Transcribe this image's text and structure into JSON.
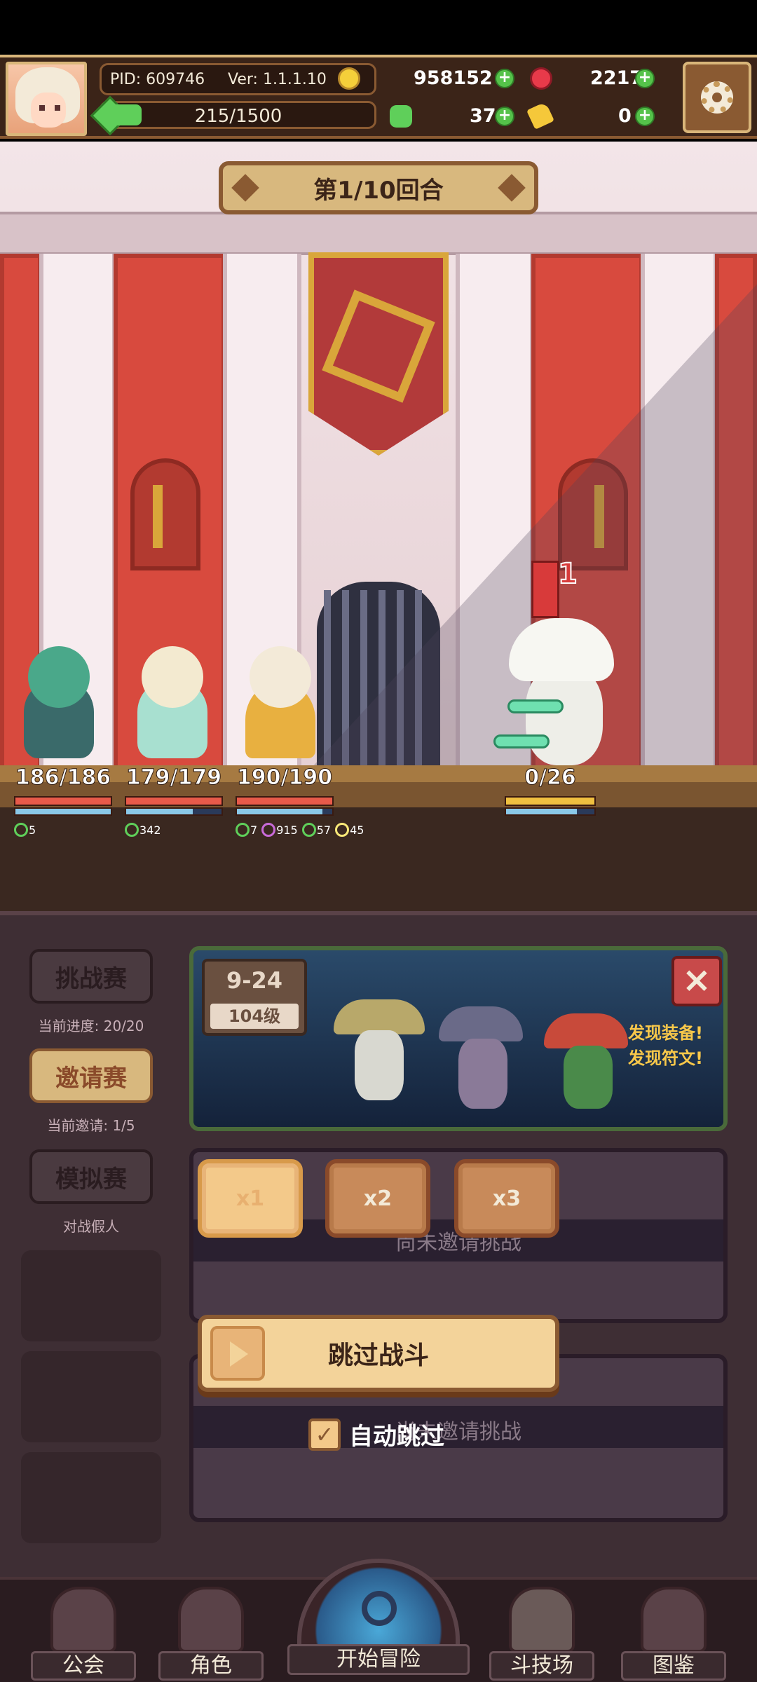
{
  "hud": {
    "pid": "PID: 609746",
    "version": "Ver: 1.1.1.10",
    "energy": "215/1500",
    "energy_fraction": 0.143,
    "coins": "958152",
    "gems": "2217",
    "clovers": "37",
    "shoes": "0",
    "icons": {
      "avatar": "player-avatar",
      "coin": "coin-icon",
      "gem": "gem-icon",
      "clover": "clover-icon",
      "shoe": "boot-icon",
      "settings": "gear-icon"
    }
  },
  "battle": {
    "round": "第1/10回合",
    "enemy_status_count": "1",
    "heroes": [
      {
        "hp": "186/186",
        "mp_fraction": 1.0,
        "buffs": [
          {
            "color": "#5fcf5a",
            "value": "5"
          }
        ]
      },
      {
        "hp": "179/179",
        "mp_fraction": 0.7,
        "buffs": [
          {
            "color": "#5fcf5a",
            "value": "342"
          }
        ]
      },
      {
        "hp": "190/190",
        "mp_fraction": 0.9,
        "buffs": [
          {
            "color": "#5fcf5a",
            "value": "7"
          },
          {
            "color": "#c86ad8",
            "value": "915"
          },
          {
            "color": "#5fcf5a",
            "value": "57"
          },
          {
            "color": "#f8e878",
            "value": "45"
          }
        ]
      }
    ],
    "enemy": {
      "hp": "0/26",
      "mp_fraction": 0.8
    }
  },
  "arena": {
    "side_buttons": [
      {
        "label": "挑战赛",
        "note": "当前进度: 20/20"
      },
      {
        "label": "邀请赛",
        "note": "当前邀请: 1/5"
      },
      {
        "label": "模拟赛",
        "note": "对战假人"
      }
    ],
    "stage": {
      "code": "9-24",
      "level": "104级",
      "msg1": "发现装备!",
      "msg2": "发现符文!"
    },
    "row_ghost_text": "尚未邀请挑战",
    "speed_buttons": [
      "x1",
      "x2",
      "x3"
    ],
    "skip_label": "跳过战斗",
    "auto_skip_label": "自动跳过"
  },
  "nav": {
    "guild": "公会",
    "role": "角色",
    "adventure": "开始冒险",
    "arena": "斗技场",
    "codex": "图鉴"
  }
}
